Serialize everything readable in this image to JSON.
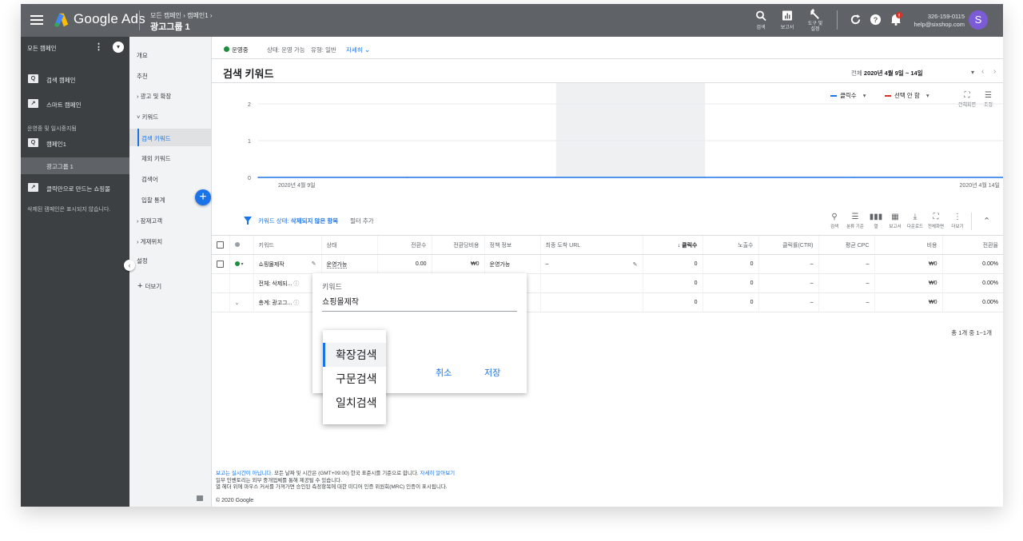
{
  "topbar": {
    "brand": "Google Ads",
    "breadcrumb": "모든 캠페인 › 캠페인1 ›",
    "title": "광고그룹 1",
    "tools": [
      {
        "name": "search",
        "label": "검색"
      },
      {
        "name": "reports",
        "label": "보고서"
      },
      {
        "name": "tools",
        "label": "도구 및 설정"
      }
    ],
    "account_id": "326-159-0115",
    "account_email": "help@sixshop.com",
    "avatar_letter": "S"
  },
  "nav1": {
    "all_campaigns": "모든 캠페인",
    "items": [
      {
        "label": "검색 캠페인"
      },
      {
        "label": "스마트 캠페인"
      }
    ],
    "section": "운영중 및 일시중지됨",
    "campaign": "캠페인1",
    "adgroup": "광고그룹 1",
    "shopping": "클릭만으로 만드는 쇼핑몰",
    "deleted_note": "삭제된 캠페인은 표시되지 않습니다."
  },
  "nav2": {
    "items": [
      "개요",
      "추천",
      "광고 및 확장",
      "키워드",
      "검색 키워드",
      "제외 키워드",
      "검색어",
      "입찰 통계",
      "잠재고객",
      "게재위치",
      "설정"
    ],
    "more": "더보기"
  },
  "status": {
    "running": "운영중",
    "state": "상태: 운영 가능",
    "type": "유형: 일반",
    "details": "자세히"
  },
  "page": {
    "title": "검색 키워드",
    "date_prefix": "전체",
    "date_range": "2020년 4월 9일 ~ 14일"
  },
  "chart": {
    "metric1": "클릭수",
    "metric2": "선택 안 함",
    "fullscreen": "전체화면",
    "adjust": "조정"
  },
  "chart_data": {
    "type": "line",
    "x": [
      "2020년 4월 9일",
      "2020년 4월 10일",
      "2020년 4월 11일",
      "2020년 4월 12일",
      "2020년 4월 13일",
      "2020년 4월 14일"
    ],
    "series": [
      {
        "name": "클릭수",
        "values": [
          0,
          0,
          0,
          0,
          0,
          0
        ]
      }
    ],
    "y_ticks": [
      0,
      1,
      2
    ],
    "ylim": [
      0,
      2
    ],
    "x_tick_labels": [
      "2020년 4월 9일",
      "2020년 4월 14일"
    ],
    "grid": true,
    "colors": {
      "series": "#1a73e8",
      "highlight": "#e8eaed"
    }
  },
  "filter": {
    "prefix": "키워드 상태:",
    "value": "삭제되지 않은 항목",
    "add": "필터 추가"
  },
  "table_tools": [
    {
      "name": "search",
      "label": "검색"
    },
    {
      "name": "segment",
      "label": "분류 기준"
    },
    {
      "name": "columns",
      "label": "열"
    },
    {
      "name": "reports",
      "label": "보고서"
    },
    {
      "name": "download",
      "label": "다운로드"
    },
    {
      "name": "fullscreen",
      "label": "전체화면"
    },
    {
      "name": "more",
      "label": "더보기"
    }
  ],
  "table": {
    "headers": [
      "키워드",
      "상태",
      "전환수",
      "전환당비용",
      "정책 정보",
      "최종 도착 URL",
      "클릭수",
      "노출수",
      "클릭률(CTR)",
      "평균 CPC",
      "비용",
      "전환율"
    ],
    "row": [
      "쇼핑몰제작",
      "운영가능",
      "0.00",
      "₩0",
      "운영가능",
      "–",
      "0",
      "0",
      "–",
      "–",
      "₩0",
      "0.00%"
    ],
    "total1": {
      "label": "전체: 삭제되...",
      "clicks": "0",
      "impr": "0",
      "ctr": "–",
      "cpc": "–",
      "cost": "₩0",
      "conv": "0.00%"
    },
    "total2": {
      "label": "총계: 광고그...",
      "clicks": "0",
      "impr": "0",
      "ctr": "–",
      "cpc": "–",
      "cost": "₩0",
      "conv": "0.00%"
    },
    "pager": "총 1개 중 1~1개"
  },
  "popover": {
    "label": "키워드",
    "value": "쇼핑몰제작",
    "cancel": "취소",
    "save": "저장",
    "options": [
      "확장검색",
      "구문검색",
      "일치검색"
    ],
    "selected": "확장검색"
  },
  "footer": {
    "line1_link": "보고는 실시간이 아닙니다.",
    "line1_text": " 모든 날짜 및 시간은 (GMT+09:00) 한국 표준시를 기준으로 합니다. ",
    "line1_link2": "자세히 알아보기",
    "line2": "일부 인벤토리는 외부 중개업체를 통해 제공될 수 있습니다.",
    "line3": "열 헤더 위에 마우스 커서를 가져가면 승인된 측정항목에 대한 미디어 인증 위원회(MRC) 인증이 표시됩니다.",
    "copyright": "© 2020 Google"
  }
}
